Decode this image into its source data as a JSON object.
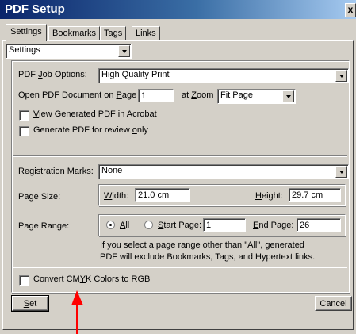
{
  "window": {
    "title": "PDF Setup",
    "close_glyph": "x"
  },
  "tabs": [
    {
      "label": "Settings",
      "active": true
    },
    {
      "label": "Bookmarks",
      "active": false
    },
    {
      "label": "Tags",
      "active": false
    },
    {
      "label": "Links",
      "active": false
    }
  ],
  "settings_preset": {
    "value": "Settings"
  },
  "job": {
    "options_label_pre": "PDF ",
    "options_label_ul": "J",
    "options_label_post": "ob Options:",
    "options_value": "High Quality Print",
    "open_label_pre": "Open PDF Document on ",
    "open_label_ul": "P",
    "open_label_post": "age",
    "open_page_value": "1",
    "zoom_label_pre": "at ",
    "zoom_label_ul": "Z",
    "zoom_label_post": "oom",
    "zoom_value": "Fit Page",
    "view_acrobat_ul": "V",
    "view_acrobat_post": "iew Generated PDF in Acrobat",
    "view_acrobat_checked": false,
    "review_pre": "Generate PDF for review ",
    "review_ul": "o",
    "review_post": "nly",
    "review_checked": false
  },
  "registration": {
    "label_ul": "R",
    "label_post": "egistration Marks:",
    "value": "None"
  },
  "page_size": {
    "label": "Page Size:",
    "width_ul": "W",
    "width_post": "idth:",
    "width_value": "21.0 cm",
    "height_ul": "H",
    "height_post": "eight:",
    "height_value": "29.7 cm"
  },
  "page_range": {
    "label": "Page Range:",
    "all_ul": "A",
    "all_post": "ll",
    "all_selected": true,
    "start_ul": "S",
    "start_post": "tart Page:",
    "start_value": "1",
    "end_ul": "E",
    "end_post": "nd Page:",
    "end_value": "26",
    "note_line1": "If you select a page range other than \"All\",  generated",
    "note_line2": "PDF will exclude Bookmarks, Tags, and Hypertext links."
  },
  "convert": {
    "label_pre": "Convert CM",
    "label_ul": "Y",
    "label_post": "K Colors to RGB",
    "checked": false
  },
  "buttons": {
    "set_ul": "S",
    "set_post": "et",
    "cancel": "Cancel"
  },
  "colors": {
    "title_bar": "#0a246a",
    "annotation_arrow": "#ff0000",
    "face": "#d4d0c8"
  }
}
